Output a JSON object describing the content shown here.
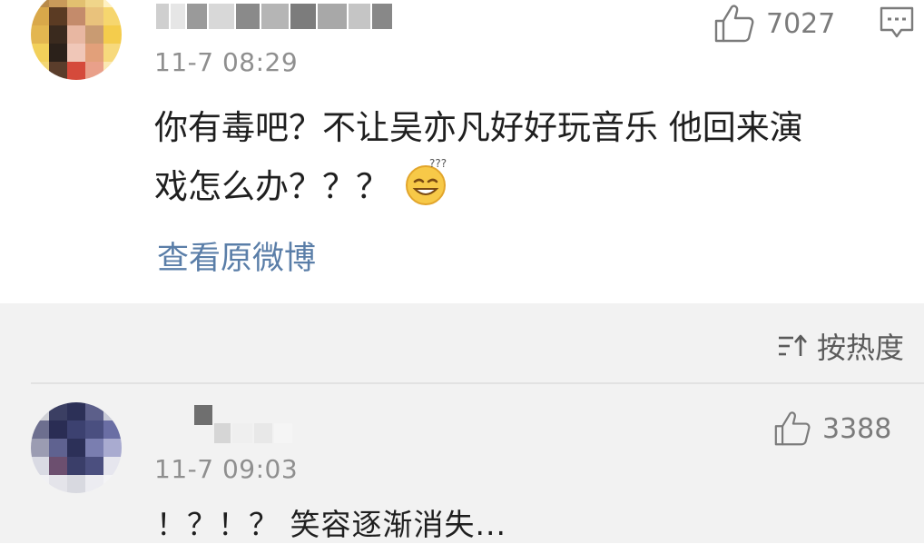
{
  "comments": [
    {
      "timestamp": "11-7 08:29",
      "likes": "7027",
      "text_line1": "你有毒吧？不让吴亦凡好好玩音乐 他回来演",
      "text_line2": "戏怎么办？？？",
      "emoji": "confused-grin-emoji",
      "view_original": "查看原微博"
    },
    {
      "timestamp": "11-7 09:03",
      "likes": "3388",
      "text": "！？！？ 笑容逐渐消失..."
    }
  ],
  "sort": {
    "label": "按热度",
    "icon": "sort-icon"
  },
  "icons": {
    "like": "thumbs-up-icon",
    "reply": "comment-icon"
  },
  "colors": {
    "link": "#5a7ea8",
    "meta": "#8f8f8f",
    "background_secondary": "#f2f2f2"
  }
}
